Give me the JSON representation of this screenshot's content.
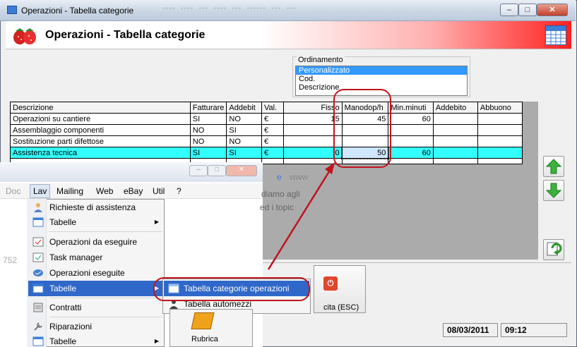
{
  "window": {
    "title": "Operazioni - Tabella categorie",
    "min": "–",
    "max": "□",
    "close": "✕"
  },
  "header": {
    "title": "Operazioni - Tabella categorie"
  },
  "sorting": {
    "legend": "Ordinamento",
    "options": [
      "Personalizzato",
      "Cod.",
      "Descrizione"
    ],
    "selected": "Personalizzato"
  },
  "grid": {
    "columns": [
      "Descrizione",
      "Fatturare",
      "Addebit",
      "Val.",
      "Fisso",
      "Manodop/h",
      "Min.minuti",
      "Addebito",
      "Abbuono"
    ],
    "rows": [
      [
        "Operazioni su cantiere",
        "SI",
        "NO",
        "€",
        "15",
        "45",
        "60",
        "",
        ""
      ],
      [
        "Assemblaggio componenti",
        "NO",
        "SI",
        "€",
        "",
        "",
        "",
        "",
        ""
      ],
      [
        "Sostituzione parti difettose",
        "NO",
        "NO",
        "€",
        "",
        "",
        "",
        "",
        ""
      ],
      [
        "Assistenza tecnica",
        "SI",
        "SI",
        "€",
        "0",
        "50",
        "60",
        "",
        ""
      ]
    ]
  },
  "side_buttons": [
    "arrow-up-icon",
    "arrow-down-icon",
    "refresh-icon"
  ],
  "esc_button": {
    "label": "cita (ESC)"
  },
  "status": {
    "date": "08/03/2011",
    "time": "09:12"
  },
  "overlay": {
    "menubar": [
      "Doc",
      "Lav",
      "Mailing",
      "Web",
      "eBay",
      "Util",
      "?"
    ],
    "behind_text": [
      "diamo agli",
      "ed i topic",
      "752",
      "www"
    ],
    "lav_menu": [
      {
        "label": "Richieste di assistenza",
        "icon": "user-icon",
        "submenu": false
      },
      {
        "label": "Tabelle",
        "icon": "table-icon",
        "submenu": true
      },
      {
        "label": "Operazioni da eseguire",
        "icon": "calendar-icon",
        "submenu": false
      },
      {
        "label": "Task manager",
        "icon": "task-icon",
        "submenu": false
      },
      {
        "label": "Operazioni eseguite",
        "icon": "done-icon",
        "submenu": false
      },
      {
        "label": "Tabelle",
        "icon": "table-icon",
        "submenu": true
      },
      {
        "label": "Contratti",
        "icon": "contract-icon",
        "submenu": false
      },
      {
        "label": "Riparazioni",
        "icon": "wrench-icon",
        "submenu": false
      },
      {
        "label": "Tabelle",
        "icon": "table-icon",
        "submenu": true
      }
    ],
    "submenu": [
      {
        "label": "Tabella categorie operazioni",
        "icon": "table-icon"
      },
      {
        "label": "Tabella automezzi",
        "icon": "person-icon"
      }
    ],
    "rubrica": "Rubrica"
  },
  "colors": {
    "highlight_row": "#33ffff",
    "menu_active": "#2f68c8",
    "annotation": "#c0141c"
  }
}
